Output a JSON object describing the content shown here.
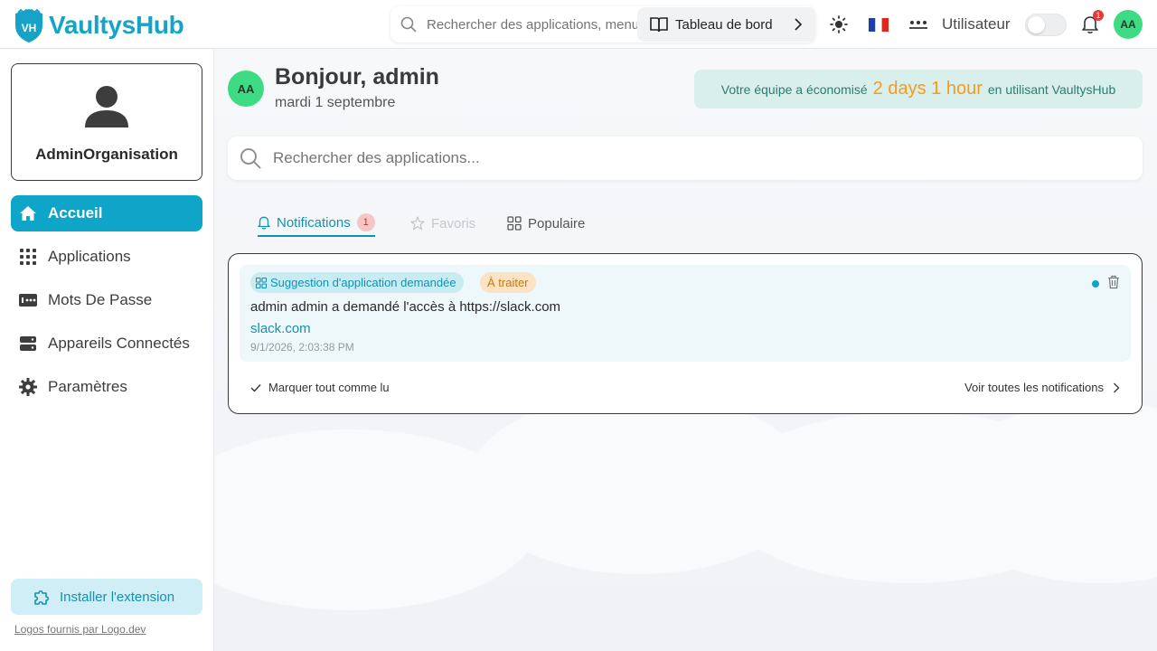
{
  "header": {
    "logo_text": "VaultysHub",
    "search_placeholder": "Rechercher des applications, menus",
    "dashboard_label": "Tableau de bord",
    "user_label": "Utilisateur",
    "notification_count": "1",
    "avatar_initials": "AA",
    "logo_badge": "VH"
  },
  "sidebar": {
    "org_name": "AdminOrganisation",
    "items": [
      {
        "label": "Accueil",
        "icon": "home-icon",
        "active": true
      },
      {
        "label": "Applications",
        "icon": "apps-grid-icon"
      },
      {
        "label": "Mots De Passe",
        "icon": "password-icon"
      },
      {
        "label": "Appareils Connectés",
        "icon": "devices-icon"
      },
      {
        "label": "Paramètres",
        "icon": "gear-icon"
      }
    ],
    "install_extension": "Installer l'extension",
    "logos_credit": "Logos fournis par Logo.dev"
  },
  "main": {
    "avatar_initials": "AA",
    "greeting": "Bonjour, admin",
    "date": "mardi 1 septembre",
    "savings": {
      "prefix": "Votre équipe a économisé",
      "highlight": "2 days 1 hour",
      "suffix": "en utilisant VaultysHub"
    },
    "search_placeholder": "Rechercher des applications...",
    "tabs": [
      {
        "label": "Notifications",
        "badge": "1",
        "active": true
      },
      {
        "label": "Favoris",
        "disabled": true
      },
      {
        "label": "Populaire"
      }
    ],
    "notification": {
      "type_tag": "Suggestion d'application demandée",
      "status_tag": "À traiter",
      "message": "admin admin a demandé l'accès à https://slack.com",
      "link": "slack.com",
      "timestamp": "9/1/2026, 2:03:38 PM"
    },
    "mark_all_read": "Marquer tout comme lu",
    "see_all": "Voir toutes les notifications"
  },
  "colors": {
    "accent": "#0ea5c9",
    "avatar_bg": "#3ddc84",
    "savings_highlight": "#f59a1b",
    "badge_red": "#e53935"
  }
}
